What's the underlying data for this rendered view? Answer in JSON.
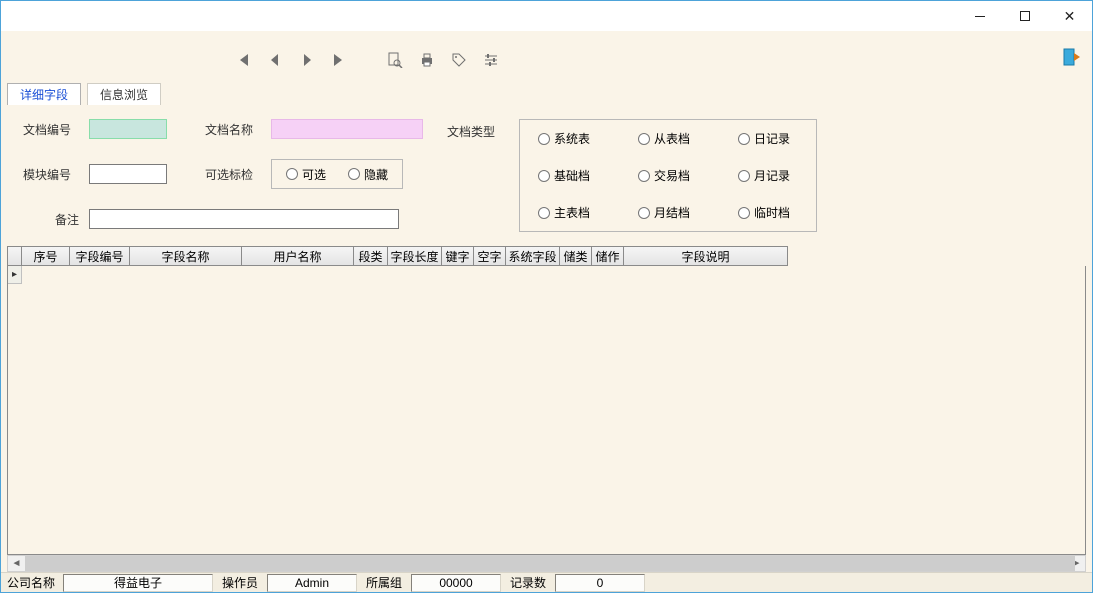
{
  "tabs": {
    "detail": "详细字段",
    "browse": "信息浏览"
  },
  "form": {
    "doc_no_label": "文档编号",
    "doc_name_label": "文档名称",
    "doc_type_label": "文档类型",
    "module_no_label": "模块编号",
    "opt_label": "可选标检",
    "remark_label": "备注",
    "doc_no": "",
    "doc_name": "",
    "module_no": "",
    "remark": "",
    "opt_optional": "可选",
    "opt_hidden": "隐藏",
    "types": {
      "r1c1": "系统表",
      "r1c2": "从表档",
      "r1c3": "日记录",
      "r2c1": "基础档",
      "r2c2": "交易档",
      "r2c3": "月记录",
      "r3c1": "主表档",
      "r3c2": "月结档",
      "r3c3": "临时档"
    }
  },
  "grid": {
    "cols": {
      "c0": "",
      "c1": "序号",
      "c2": "字段编号",
      "c3": "字段名称",
      "c4": "用户名称",
      "c5": "段类",
      "c6": "字段长度",
      "c7": "键字",
      "c8": "空字",
      "c9": "系统字段",
      "c10": "储类",
      "c11": "储作",
      "c12": "字段说明"
    },
    "rowmark": "▸"
  },
  "status": {
    "company_label": "公司名称",
    "company_value": "得益电子",
    "operator_label": "操作员",
    "operator_value": "Admin",
    "group_label": "所属组",
    "group_value": "00000",
    "count_label": "记录数",
    "count_value": "0"
  }
}
